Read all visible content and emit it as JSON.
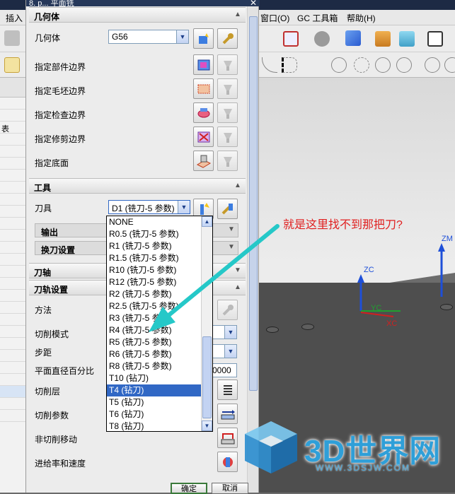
{
  "app": {
    "title_fragment": "8. p... 平面铣",
    "menu": [
      "插入",
      "窗口(O)",
      "GC 工具箱",
      "帮助(H)"
    ],
    "left_panel_label": "表"
  },
  "dialog": {
    "sections": {
      "geometry": {
        "header": "几何体",
        "geometry_label": "几何体",
        "geometry_value": "G56",
        "rows": [
          "指定部件边界",
          "指定毛坯边界",
          "指定检查边界",
          "指定修剪边界",
          "指定底面"
        ]
      },
      "tool": {
        "header": "工具",
        "tool_label": "刀具",
        "tool_value": "D1 (铣刀-5 参数)",
        "output": "输出",
        "tool_change": "换刀设置"
      },
      "axis": {
        "header": "刀轴"
      },
      "path": {
        "header": "刀轨设置",
        "rows": [
          "方法",
          "切削模式",
          "步距",
          "平面直径百分比",
          "切削层",
          "切削参数",
          "非切削移动",
          "进给率和速度"
        ],
        "diameter_percent_value": "0000"
      }
    },
    "ok": "确定",
    "cancel": "取消"
  },
  "dropdown": {
    "items": [
      "NONE",
      "R0.5 (铣刀-5 参数)",
      "R1 (铣刀-5 参数)",
      "R1.5 (铣刀-5 参数)",
      "R10 (铣刀-5 参数)",
      "R12 (铣刀-5 参数)",
      "R2 (铣刀-5 参数)",
      "R2.5 (铣刀-5 参数)",
      "R3 (铣刀-5 参数)",
      "R4 (铣刀-5 参数)",
      "R5 (铣刀-5 参数)",
      "R6 (铣刀-5 参数)",
      "R8 (铣刀-5 参数)",
      "T10 (钻刀)",
      "T4 (钻刀)",
      "T5 (钻刀)",
      "T6 (钻刀)",
      "T8 (钻刀)"
    ],
    "selected_index": 14
  },
  "annotation": {
    "text": "就是这里找不到那把刀?"
  },
  "viewport": {
    "axes": [
      "ZM",
      "ZC",
      "YC",
      "XC"
    ]
  },
  "watermark": {
    "brand": "3D世界网",
    "url": "WWW.3DSJW.COM"
  },
  "colors": {
    "selection": "#3168c5",
    "annotation": "#e02020",
    "arrow": "#25c8c8",
    "watermark": "#2f9fd8"
  }
}
